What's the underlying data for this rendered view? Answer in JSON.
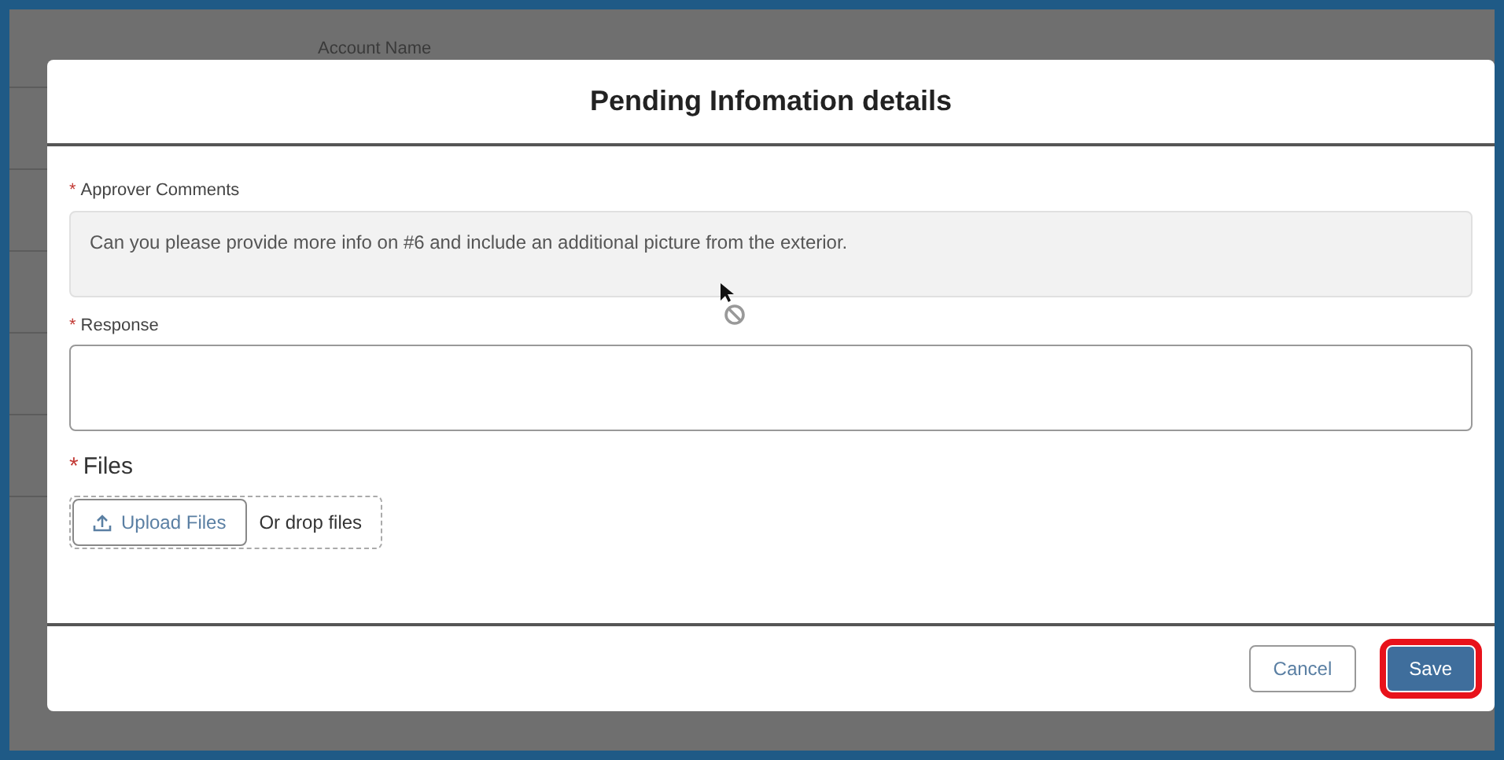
{
  "background": {
    "column_header": "Account Name"
  },
  "modal": {
    "title": "Pending Infomation details",
    "fields": [
      {
        "label": "Approver Comments",
        "required_mark": "*",
        "value": "Can you please provide more info on #6 and include an additional picture from the exterior.",
        "disabled": true
      },
      {
        "label": "Response",
        "required_mark": "*",
        "disabled": false
      }
    ],
    "files": {
      "label": "Files",
      "required_mark": "*",
      "upload_button": "Upload Files",
      "drop_text": "Or drop files"
    },
    "buttons": [
      {
        "label": "Cancel",
        "kind": "neutral",
        "highlighted": false
      },
      {
        "label": "Save",
        "kind": "brand",
        "highlighted": true
      }
    ]
  }
}
